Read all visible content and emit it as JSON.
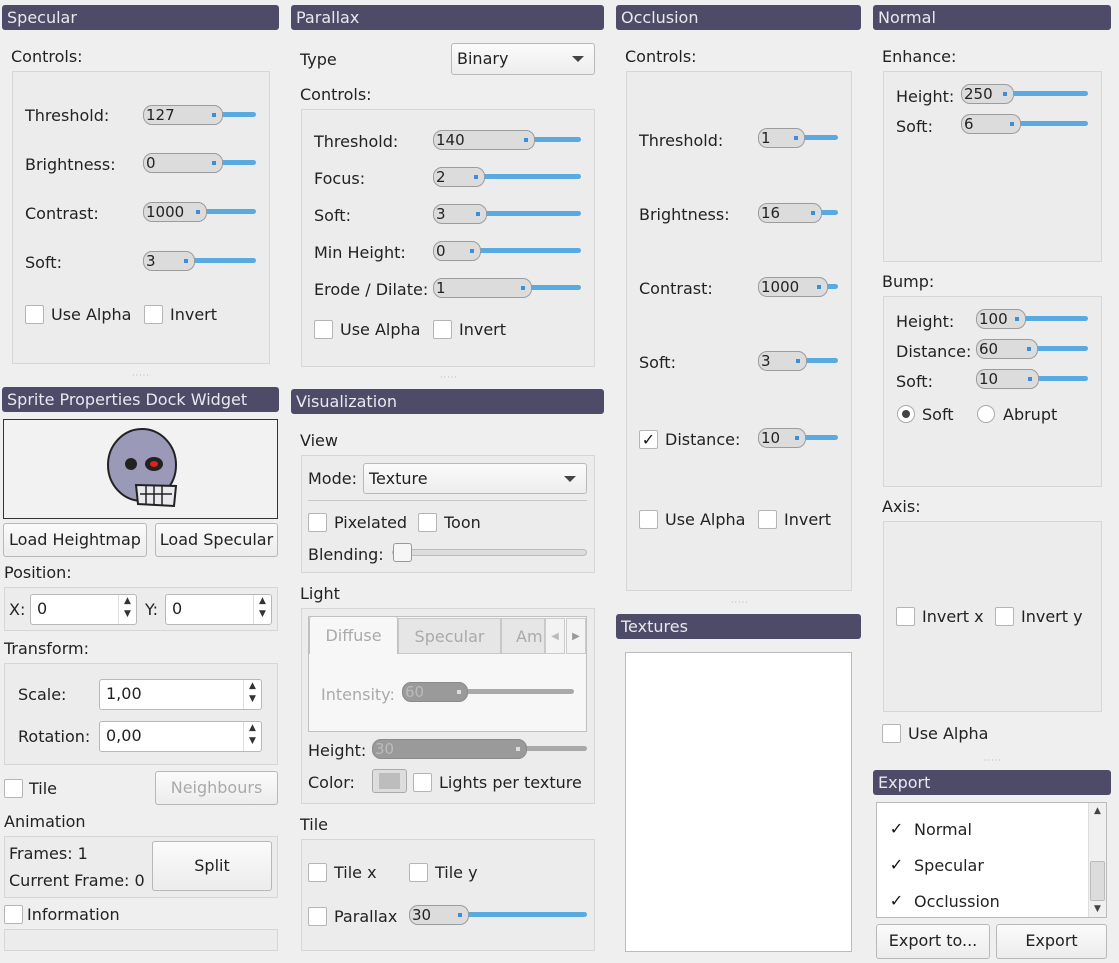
{
  "specular": {
    "title": "Specular",
    "controls": "Controls:",
    "threshold_label": "Threshold:",
    "threshold": "127",
    "brightness_label": "Brightness:",
    "brightness": "0",
    "contrast_label": "Contrast:",
    "contrast": "1000",
    "soft_label": "Soft:",
    "soft": "3",
    "use_alpha": "Use Alpha",
    "invert": "Invert"
  },
  "parallax": {
    "title": "Parallax",
    "type_label": "Type",
    "type_value": "Binary",
    "controls": "Controls:",
    "threshold_label": "Threshold:",
    "threshold": "140",
    "focus_label": "Focus:",
    "focus": "2",
    "soft_label": "Soft:",
    "soft": "3",
    "minh_label": "Min Height:",
    "minh": "0",
    "erode_label": "Erode / Dilate:",
    "erode": "1",
    "use_alpha": "Use Alpha",
    "invert": "Invert"
  },
  "occlusion": {
    "title": "Occlusion",
    "controls": "Controls:",
    "threshold_label": "Threshold:",
    "threshold": "1",
    "brightness_label": "Brightness:",
    "brightness": "16",
    "contrast_label": "Contrast:",
    "contrast": "1000",
    "soft_label": "Soft:",
    "soft": "3",
    "distance_label": "Distance:",
    "distance": "10",
    "use_alpha": "Use Alpha",
    "invert": "Invert"
  },
  "normal": {
    "title": "Normal",
    "enhance": "Enhance:",
    "height_label": "Height:",
    "height": "250",
    "soft_label": "Soft:",
    "soft": "6",
    "bump": "Bump:",
    "bheight_label": "Height:",
    "bheight": "100",
    "bdist_label": "Distance:",
    "bdist": "60",
    "bsoft_label": "Soft:",
    "bsoft": "10",
    "radio_soft": "Soft",
    "radio_abrupt": "Abrupt",
    "axis": "Axis:",
    "invert_x": "Invert x",
    "invert_y": "Invert y",
    "use_alpha": "Use Alpha"
  },
  "sprite": {
    "title": "Sprite Properties Dock Widget",
    "load_heightmap": "Load Heightmap",
    "load_specular": "Load Specular",
    "position": "Position:",
    "x_label": "X:",
    "x": "0",
    "y_label": "Y:",
    "y": "0",
    "transform": "Transform:",
    "scale_label": "Scale:",
    "scale": "1,00",
    "rotation_label": "Rotation:",
    "rotation": "0,00",
    "tile": "Tile",
    "neighbours": "Neighbours",
    "animation": "Animation",
    "frames": "Frames: 1",
    "current_frame": "Current Frame: 0",
    "split": "Split",
    "information": "Information"
  },
  "vis": {
    "title": "Visualization",
    "view": "View",
    "mode_label": "Mode:",
    "mode": "Texture",
    "pixelated": "Pixelated",
    "toon": "Toon",
    "blending": "Blending:",
    "light": "Light",
    "tab_diffuse": "Diffuse",
    "tab_specular": "Specular",
    "tab_am": "Am",
    "intensity_label": "Intensity:",
    "intensity": "60",
    "height_label": "Height:",
    "height": "30",
    "color_label": "Color:",
    "lights_per_texture": "Lights per texture",
    "tile": "Tile",
    "tile_x": "Tile x",
    "tile_y": "Tile y",
    "parallax": "Parallax",
    "parallax_val": "30"
  },
  "textures": {
    "title": "Textures"
  },
  "export": {
    "title": "Export",
    "items": [
      "Normal",
      "Specular",
      "Occlussion"
    ],
    "export_to": "Export to...",
    "export": "Export"
  }
}
